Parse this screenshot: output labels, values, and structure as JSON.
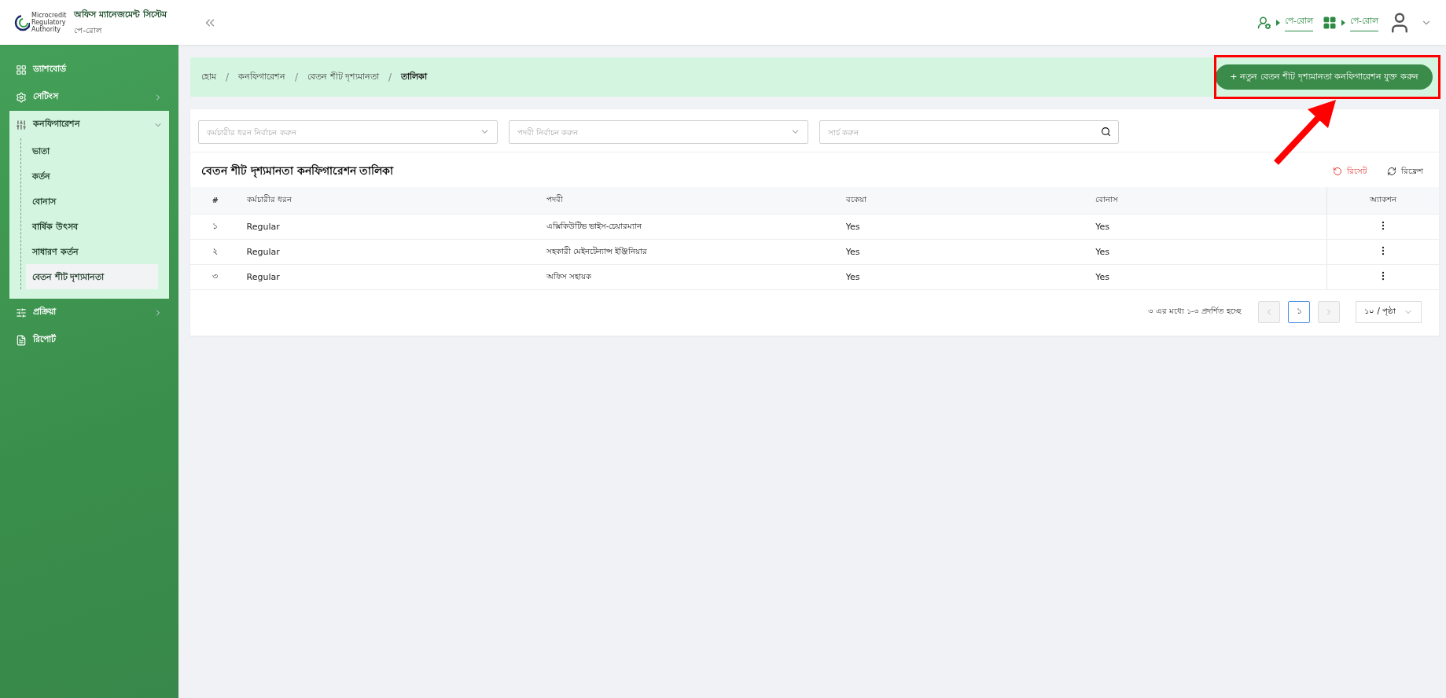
{
  "header": {
    "app_title": "অফিস ম্যানেজমেন্ট সিস্টেম",
    "app_subtitle": "পে-রোল",
    "logo_text": [
      "Microcredit",
      "Regulatory",
      "Authority"
    ],
    "links": [
      {
        "kind": "user",
        "label": "পে-রোল"
      },
      {
        "kind": "grid",
        "label": "পে-রোল"
      }
    ]
  },
  "sidebar": {
    "items": [
      {
        "label": "ড্যাশবোর্ড",
        "expanded": false
      },
      {
        "label": "সেটিংস",
        "expanded": false
      },
      {
        "label": "কনফিগারেশন",
        "expanded": true,
        "children": [
          {
            "label": "ভাতা",
            "selected": false
          },
          {
            "label": "কর্তন",
            "selected": false
          },
          {
            "label": "বোনাস",
            "selected": false
          },
          {
            "label": "বার্ষিক উৎসব",
            "selected": false
          },
          {
            "label": "সাধারণ কর্তন",
            "selected": false
          },
          {
            "label": "বেতন শীট দৃশ্যমানতা",
            "selected": true
          }
        ]
      },
      {
        "label": "প্রক্রিয়া",
        "expanded": false
      },
      {
        "label": "রিপোর্ট",
        "expanded": false
      }
    ]
  },
  "breadcrumb": {
    "separator": "/",
    "items": [
      "হোম",
      "কনফিগারেশন",
      "বেতন শীট দৃশ্যমানতা",
      "তালিকা"
    ]
  },
  "add_button": "+ নতুন বেতন শীট দৃশ্যমানতা কনফিগারেশন যুক্ত করুন",
  "filters": [
    {
      "kind": "select",
      "placeholder": "কর্মচারীর ধরন নির্বাচন করুন"
    },
    {
      "kind": "select",
      "placeholder": "পদবী নির্বাচন করুন"
    },
    {
      "kind": "search",
      "placeholder": "সার্চ করুন"
    }
  ],
  "table": {
    "title": "বেতন শীট দৃশ্যমানতা কনফিগারেশন তালিকা",
    "reset": "রিসেট",
    "refresh": "রিফ্রেশ",
    "columns": [
      "#",
      "কর্মচারীর ধরন",
      "পদবী",
      "বকেয়া",
      "বোনাস",
      "অ্যাকশন"
    ],
    "rows": [
      [
        "১",
        "Regular",
        "এক্সিকিউটিভ ভাইস-চেয়ারম্যান",
        "Yes",
        "Yes"
      ],
      [
        "২",
        "Regular",
        "সহকারী মেইনটেন্যান্স ইঞ্জিনিয়ার",
        "Yes",
        "Yes"
      ],
      [
        "৩",
        "Regular",
        "অফিস সহায়ক",
        "Yes",
        "Yes"
      ]
    ]
  },
  "pagination": {
    "summary": "৩ এর মধ্যে ১-৩ প্রদর্শিত হচ্ছে",
    "pages": [
      {
        "label": "১",
        "selected": true
      }
    ],
    "page_size": "১০ / পৃষ্ঠা"
  }
}
